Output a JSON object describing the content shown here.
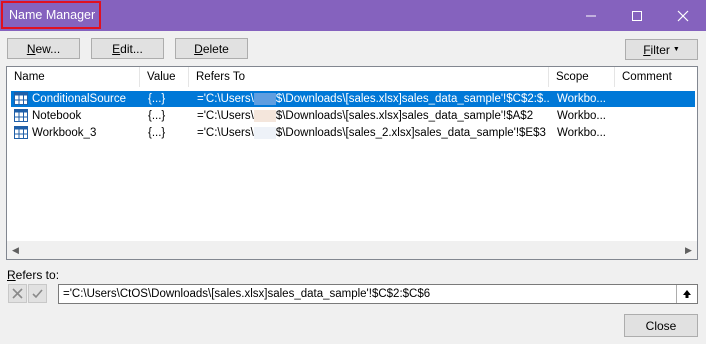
{
  "window": {
    "title": "Name Manager"
  },
  "controls": {
    "minimize": "–",
    "maximize": "☐",
    "close": "✕"
  },
  "toolbar": {
    "new_label": "ew...",
    "new_key": "N",
    "edit_label": "dit...",
    "edit_key": "E",
    "delete_label": "elete",
    "delete_key": "D",
    "filter_label": "ilter",
    "filter_key": "F"
  },
  "columns": [
    "Name",
    "Value",
    "Refers To",
    "Scope",
    "Comment"
  ],
  "rows": [
    {
      "name": "ConditionalSource",
      "value": "{...}",
      "refers_prefix": "='C:\\Users\\",
      "refers_suffix": "$\\Downloads\\[sales.xlsx]sales_data_sample'!$C$2:$...",
      "scope": "Workbo...",
      "comment": "",
      "selected": true
    },
    {
      "name": "Notebook",
      "value": "{...}",
      "refers_prefix": "='C:\\Users\\",
      "refers_suffix": "$\\Downloads\\[sales.xlsx]sales_data_sample'!$A$2",
      "scope": "Workbo...",
      "comment": "",
      "selected": false
    },
    {
      "name": "Workbook_3",
      "value": "{...}",
      "refers_prefix": "='C:\\Users\\",
      "refers_suffix": "$\\Downloads\\[sales_2.xlsx]sales_data_sample'!$E$3",
      "scope": "Workbo...",
      "comment": "",
      "selected": false
    }
  ],
  "refers_to": {
    "label_key": "R",
    "label_rest": "efers to:",
    "value": "='C:\\Users\\CtOS\\Downloads\\[sales.xlsx]sales_data_sample'!$C$2:$C$6"
  },
  "footer": {
    "close_label": "Close"
  },
  "colors": {
    "titlebar": "#8562be",
    "selection": "#0078d7",
    "highlight_box": "#e01020"
  }
}
